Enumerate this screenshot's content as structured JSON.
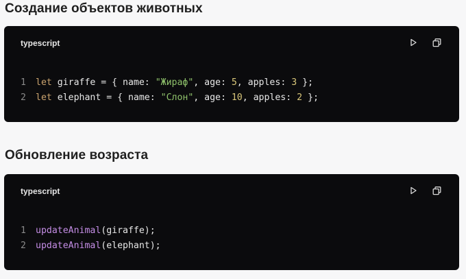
{
  "sections": [
    {
      "title": "Создание объектов животных",
      "lang": "typescript",
      "lines": [
        {
          "num": "1",
          "tokens": [
            {
              "t": "let",
              "c": "kw"
            },
            {
              "t": " giraffe = { name: ",
              "c": ""
            },
            {
              "t": "\"Жираф\"",
              "c": "str"
            },
            {
              "t": ", age: ",
              "c": ""
            },
            {
              "t": "5",
              "c": "num"
            },
            {
              "t": ", apples: ",
              "c": ""
            },
            {
              "t": "3",
              "c": "num"
            },
            {
              "t": " };",
              "c": ""
            }
          ]
        },
        {
          "num": "2",
          "tokens": [
            {
              "t": "let",
              "c": "kw"
            },
            {
              "t": " elephant = { name: ",
              "c": ""
            },
            {
              "t": "\"Слон\"",
              "c": "str"
            },
            {
              "t": ", age: ",
              "c": ""
            },
            {
              "t": "10",
              "c": "num"
            },
            {
              "t": ", apples: ",
              "c": ""
            },
            {
              "t": "2",
              "c": "num"
            },
            {
              "t": " };",
              "c": ""
            }
          ]
        }
      ]
    },
    {
      "title": "Обновление возраста",
      "lang": "typescript",
      "lines": [
        {
          "num": "1",
          "tokens": [
            {
              "t": "updateAnimal",
              "c": "fn"
            },
            {
              "t": "(giraffe);",
              "c": ""
            }
          ]
        },
        {
          "num": "2",
          "tokens": [
            {
              "t": "updateAnimal",
              "c": "fn"
            },
            {
              "t": "(elephant);",
              "c": ""
            }
          ]
        }
      ]
    }
  ],
  "icons": {
    "run": "play-icon",
    "copy": "copy-icon"
  },
  "colors": {
    "background": "#f7f7f8",
    "card": "#0b0b0d",
    "keyword": "#caa36e",
    "string": "#8fc26b",
    "number": "#d9c77a",
    "function": "#c58ee6"
  }
}
